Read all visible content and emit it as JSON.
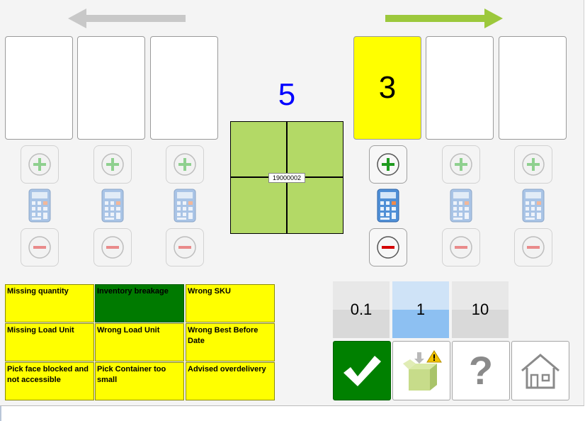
{
  "nav": {
    "back_arrow_color": "#c8c8c8",
    "forward_arrow_color": "#9cc83c"
  },
  "slots_left": [
    "",
    "",
    ""
  ],
  "slots_right": [
    "3",
    "",
    ""
  ],
  "center": {
    "count": "5",
    "count_color": "#0000ff",
    "container_id": "19000002",
    "grid_color": "#b3d966"
  },
  "reasons": [
    {
      "label": "Missing quantity",
      "color": "#ffff00"
    },
    {
      "label": "Inventory breakage",
      "color": "#007a00"
    },
    {
      "label": "Wrong SKU",
      "color": "#ffff00"
    },
    {
      "label": "Missing Load Unit",
      "color": "#ffff00"
    },
    {
      "label": "Wrong Load Unit",
      "color": "#ffff00"
    },
    {
      "label": "Wrong Best Before Date",
      "color": "#ffff00"
    },
    {
      "label": "Pick face blocked and not accessible",
      "color": "#ffff00"
    },
    {
      "label": "Pick Container too small",
      "color": "#ffff00"
    },
    {
      "label": "Advised overdelivery",
      "color": "#ffff00"
    }
  ],
  "quantity_steps": [
    {
      "label": "0.1",
      "selected": false
    },
    {
      "label": "1",
      "selected": true
    },
    {
      "label": "10",
      "selected": false
    }
  ],
  "actions": {
    "confirm_icon": "checkmark-icon",
    "confirm_color": "#008000",
    "damaged_box_icon": "box-warning-icon",
    "help_icon": "question-mark-icon",
    "home_icon": "home-icon"
  }
}
